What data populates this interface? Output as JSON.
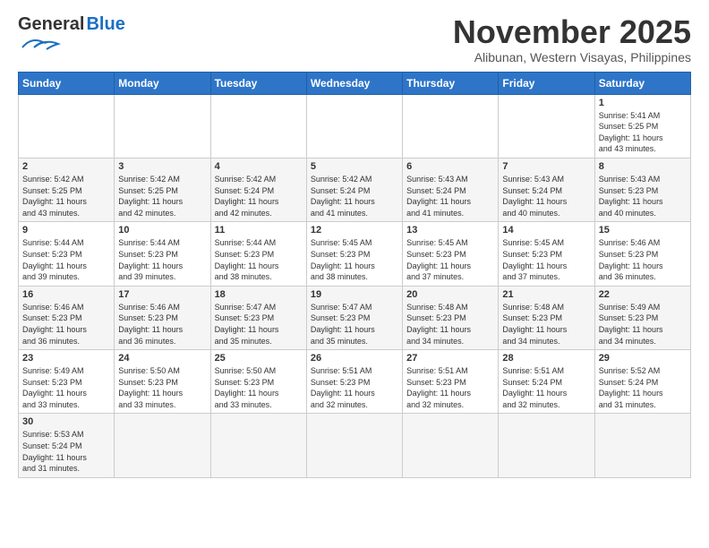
{
  "header": {
    "logo_general": "General",
    "logo_blue": "Blue",
    "month_title": "November 2025",
    "subtitle": "Alibunan, Western Visayas, Philippines"
  },
  "days_of_week": [
    "Sunday",
    "Monday",
    "Tuesday",
    "Wednesday",
    "Thursday",
    "Friday",
    "Saturday"
  ],
  "weeks": [
    [
      {
        "day": "",
        "info": ""
      },
      {
        "day": "",
        "info": ""
      },
      {
        "day": "",
        "info": ""
      },
      {
        "day": "",
        "info": ""
      },
      {
        "day": "",
        "info": ""
      },
      {
        "day": "",
        "info": ""
      },
      {
        "day": "1",
        "info": "Sunrise: 5:41 AM\nSunset: 5:25 PM\nDaylight: 11 hours\nand 43 minutes."
      }
    ],
    [
      {
        "day": "2",
        "info": "Sunrise: 5:42 AM\nSunset: 5:25 PM\nDaylight: 11 hours\nand 43 minutes."
      },
      {
        "day": "3",
        "info": "Sunrise: 5:42 AM\nSunset: 5:25 PM\nDaylight: 11 hours\nand 42 minutes."
      },
      {
        "day": "4",
        "info": "Sunrise: 5:42 AM\nSunset: 5:24 PM\nDaylight: 11 hours\nand 42 minutes."
      },
      {
        "day": "5",
        "info": "Sunrise: 5:42 AM\nSunset: 5:24 PM\nDaylight: 11 hours\nand 41 minutes."
      },
      {
        "day": "6",
        "info": "Sunrise: 5:43 AM\nSunset: 5:24 PM\nDaylight: 11 hours\nand 41 minutes."
      },
      {
        "day": "7",
        "info": "Sunrise: 5:43 AM\nSunset: 5:24 PM\nDaylight: 11 hours\nand 40 minutes."
      },
      {
        "day": "8",
        "info": "Sunrise: 5:43 AM\nSunset: 5:23 PM\nDaylight: 11 hours\nand 40 minutes."
      }
    ],
    [
      {
        "day": "9",
        "info": "Sunrise: 5:44 AM\nSunset: 5:23 PM\nDaylight: 11 hours\nand 39 minutes."
      },
      {
        "day": "10",
        "info": "Sunrise: 5:44 AM\nSunset: 5:23 PM\nDaylight: 11 hours\nand 39 minutes."
      },
      {
        "day": "11",
        "info": "Sunrise: 5:44 AM\nSunset: 5:23 PM\nDaylight: 11 hours\nand 38 minutes."
      },
      {
        "day": "12",
        "info": "Sunrise: 5:45 AM\nSunset: 5:23 PM\nDaylight: 11 hours\nand 38 minutes."
      },
      {
        "day": "13",
        "info": "Sunrise: 5:45 AM\nSunset: 5:23 PM\nDaylight: 11 hours\nand 37 minutes."
      },
      {
        "day": "14",
        "info": "Sunrise: 5:45 AM\nSunset: 5:23 PM\nDaylight: 11 hours\nand 37 minutes."
      },
      {
        "day": "15",
        "info": "Sunrise: 5:46 AM\nSunset: 5:23 PM\nDaylight: 11 hours\nand 36 minutes."
      }
    ],
    [
      {
        "day": "16",
        "info": "Sunrise: 5:46 AM\nSunset: 5:23 PM\nDaylight: 11 hours\nand 36 minutes."
      },
      {
        "day": "17",
        "info": "Sunrise: 5:46 AM\nSunset: 5:23 PM\nDaylight: 11 hours\nand 36 minutes."
      },
      {
        "day": "18",
        "info": "Sunrise: 5:47 AM\nSunset: 5:23 PM\nDaylight: 11 hours\nand 35 minutes."
      },
      {
        "day": "19",
        "info": "Sunrise: 5:47 AM\nSunset: 5:23 PM\nDaylight: 11 hours\nand 35 minutes."
      },
      {
        "day": "20",
        "info": "Sunrise: 5:48 AM\nSunset: 5:23 PM\nDaylight: 11 hours\nand 34 minutes."
      },
      {
        "day": "21",
        "info": "Sunrise: 5:48 AM\nSunset: 5:23 PM\nDaylight: 11 hours\nand 34 minutes."
      },
      {
        "day": "22",
        "info": "Sunrise: 5:49 AM\nSunset: 5:23 PM\nDaylight: 11 hours\nand 34 minutes."
      }
    ],
    [
      {
        "day": "23",
        "info": "Sunrise: 5:49 AM\nSunset: 5:23 PM\nDaylight: 11 hours\nand 33 minutes."
      },
      {
        "day": "24",
        "info": "Sunrise: 5:50 AM\nSunset: 5:23 PM\nDaylight: 11 hours\nand 33 minutes."
      },
      {
        "day": "25",
        "info": "Sunrise: 5:50 AM\nSunset: 5:23 PM\nDaylight: 11 hours\nand 33 minutes."
      },
      {
        "day": "26",
        "info": "Sunrise: 5:51 AM\nSunset: 5:23 PM\nDaylight: 11 hours\nand 32 minutes."
      },
      {
        "day": "27",
        "info": "Sunrise: 5:51 AM\nSunset: 5:23 PM\nDaylight: 11 hours\nand 32 minutes."
      },
      {
        "day": "28",
        "info": "Sunrise: 5:51 AM\nSunset: 5:24 PM\nDaylight: 11 hours\nand 32 minutes."
      },
      {
        "day": "29",
        "info": "Sunrise: 5:52 AM\nSunset: 5:24 PM\nDaylight: 11 hours\nand 31 minutes."
      }
    ],
    [
      {
        "day": "30",
        "info": "Sunrise: 5:53 AM\nSunset: 5:24 PM\nDaylight: 11 hours\nand 31 minutes."
      },
      {
        "day": "",
        "info": ""
      },
      {
        "day": "",
        "info": ""
      },
      {
        "day": "",
        "info": ""
      },
      {
        "day": "",
        "info": ""
      },
      {
        "day": "",
        "info": ""
      },
      {
        "day": "",
        "info": ""
      }
    ]
  ]
}
